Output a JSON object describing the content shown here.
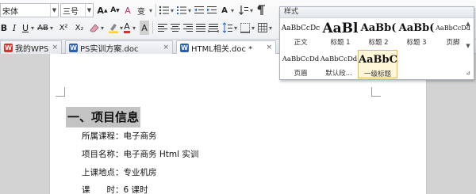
{
  "toolbar": {
    "font_name": "宋体",
    "font_size": "三号",
    "grow_font": "A",
    "shrink_font": "A",
    "clear_format": "A",
    "phonetic": "变",
    "bold": "B",
    "italic": "I",
    "underline": "U",
    "strike": "AB",
    "superscript": "X²",
    "subscript": "X₂",
    "font_color": "A",
    "highlight": "A",
    "char_border": "A",
    "char_shading": "A"
  },
  "tabs": [
    {
      "label": "我的WPS"
    },
    {
      "label": "PS实训方案.doc"
    },
    {
      "label": "HTML相关.doc *"
    }
  ],
  "styles_panel": {
    "title": "样式",
    "styles": [
      {
        "sample": "AaBbCcDc",
        "name": "正文"
      },
      {
        "sample": "AaBl",
        "name": "标题 1"
      },
      {
        "sample": "AaBb(",
        "name": "标题 2"
      },
      {
        "sample": "AaBb(",
        "name": "标题 3"
      },
      {
        "sample": "AaBbCcDd",
        "name": "页脚"
      },
      {
        "sample": "AaBbCcDd",
        "name": "页眉"
      },
      {
        "sample": "AaBbCcDd",
        "name": "默认段..."
      },
      {
        "sample": "AaBbC",
        "name": "一级标题"
      }
    ]
  },
  "document": {
    "heading": "一、项目信息",
    "lines": [
      "所属课程：电子商务",
      "项目名称：电子商务 Html 实训",
      "上课地点：专业机房",
      "课　　时：6 课时"
    ]
  },
  "colors": {
    "font_color_bar": "#e0301e",
    "highlight_bar": "#2266cc",
    "selected_style_border": "#e8b84a"
  }
}
